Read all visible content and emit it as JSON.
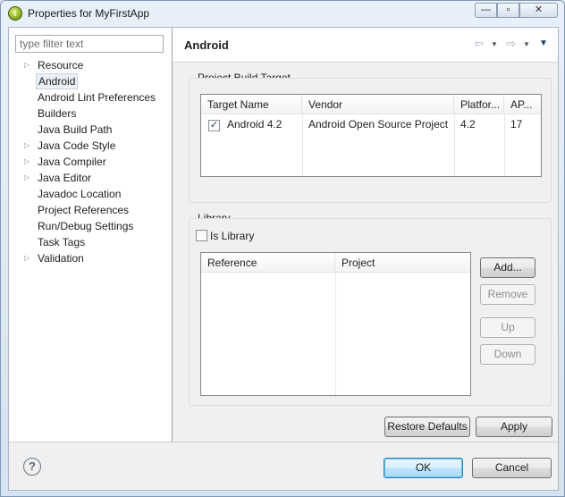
{
  "window": {
    "title": "Properties for MyFirstApp",
    "minimize_glyph": "—",
    "maximize_glyph": "▫",
    "close_glyph": "✕",
    "app_icon_glyph": "i"
  },
  "filter": {
    "placeholder": "type filter text"
  },
  "tree": {
    "items": [
      {
        "label": "Resource",
        "expandable": true
      },
      {
        "label": "Android",
        "expandable": false,
        "selected": true
      },
      {
        "label": "Android Lint Preferences",
        "expandable": false
      },
      {
        "label": "Builders",
        "expandable": false
      },
      {
        "label": "Java Build Path",
        "expandable": false
      },
      {
        "label": "Java Code Style",
        "expandable": true
      },
      {
        "label": "Java Compiler",
        "expandable": true
      },
      {
        "label": "Java Editor",
        "expandable": true
      },
      {
        "label": "Javadoc Location",
        "expandable": false
      },
      {
        "label": "Project References",
        "expandable": false
      },
      {
        "label": "Run/Debug Settings",
        "expandable": false
      },
      {
        "label": "Task Tags",
        "expandable": false
      },
      {
        "label": "Validation",
        "expandable": true
      }
    ],
    "expand_glyph": "▷"
  },
  "page": {
    "title": "Android",
    "nav": {
      "back": "⇦",
      "forward": "⇨",
      "dropdown": "▼",
      "menu": "▼"
    }
  },
  "build_target": {
    "group_label": "Project Build Target",
    "columns": [
      "Target Name",
      "Vendor",
      "Platfor...",
      "AP..."
    ],
    "rows": [
      {
        "checked": true,
        "name": "Android 4.2",
        "vendor": "Android Open Source Project",
        "platform": "4.2",
        "api": "17"
      }
    ],
    "check_glyph": "✓"
  },
  "library": {
    "group_label": "Library",
    "is_library_label": "Is Library",
    "is_library_checked": false,
    "columns": [
      "Reference",
      "Project"
    ],
    "buttons": {
      "add": "Add...",
      "remove": "Remove",
      "up": "Up",
      "down": "Down"
    }
  },
  "page_buttons": {
    "restore_defaults": "Restore Defaults",
    "apply": "Apply"
  },
  "dialog_buttons": {
    "ok": "OK",
    "cancel": "Cancel",
    "help_glyph": "?"
  }
}
